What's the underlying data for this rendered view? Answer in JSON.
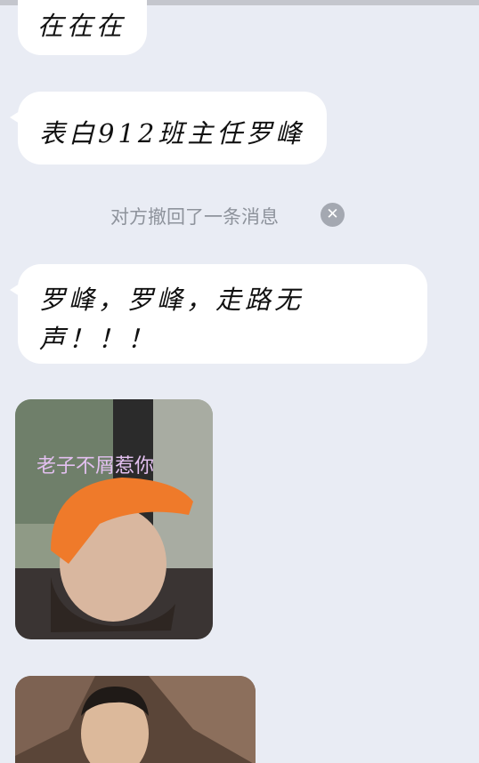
{
  "messages": [
    {
      "text": "在在在"
    },
    {
      "text": "表白912班主任罗峰"
    },
    {
      "text": "罗峰，罗峰，走路无声！！！"
    }
  ],
  "recall_notice": "对方撤回了一条消息",
  "recall_icon": "close-circle-icon",
  "sticker_caption": "老子不屑惹你",
  "colors": {
    "background": "#e9ecf4",
    "bubble": "#ffffff",
    "notice_text": "#8e939c"
  }
}
